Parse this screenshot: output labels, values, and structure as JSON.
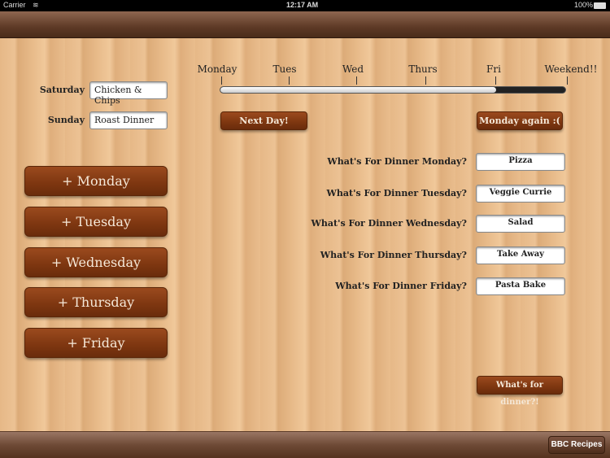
{
  "status": {
    "carrier": "Carrier",
    "time": "12:17 AM",
    "battery": "100%"
  },
  "progress": {
    "days": [
      "Monday",
      "Tues",
      "Wed",
      "Thurs",
      "Fri",
      "Weekend!!"
    ],
    "value_percent": 80,
    "current": "Fri"
  },
  "weekend": {
    "saturday_label": "Saturday",
    "saturday_value": "Chicken & Chips",
    "sunday_label": "Sunday",
    "sunday_value": "Roast Dinner"
  },
  "buttons": {
    "next_day": "Next Day!",
    "monday_again": "Monday again :(",
    "whats_for_dinner": "What's for dinner?!",
    "bbc": "BBC Recipes"
  },
  "add_buttons": [
    "+ Monday",
    "+ Tuesday",
    "+ Wednesday",
    "+ Thursday",
    "+ Friday"
  ],
  "dinners": [
    {
      "label": "What's For Dinner Monday?",
      "value": "Pizza"
    },
    {
      "label": "What's For Dinner Tuesday?",
      "value": "Veggie Currie"
    },
    {
      "label": "What's For Dinner Wednesday?",
      "value": "Salad"
    },
    {
      "label": "What's For Dinner Thursday?",
      "value": "Take Away"
    },
    {
      "label": "What's For Dinner Friday?",
      "value": "Pasta Bake"
    }
  ]
}
